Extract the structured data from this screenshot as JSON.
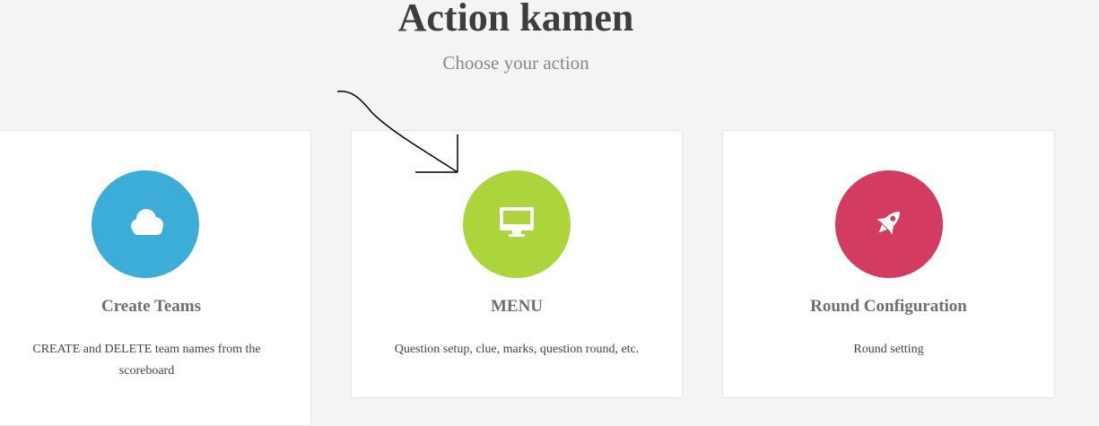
{
  "header": {
    "title": "Action kamen",
    "subtitle": "Choose your action"
  },
  "cards": [
    {
      "title": "Create Teams",
      "description": "CREATE and DELETE team names from the scoreboard",
      "icon": "cloud-icon",
      "color": "#3badd6"
    },
    {
      "title": "MENU",
      "description": "Question setup, clue, marks, question round, etc.",
      "icon": "desktop-icon",
      "color": "#add43b"
    },
    {
      "title": "Round Configuration",
      "description": "Round setting",
      "icon": "rocket-icon",
      "color": "#d43b63"
    }
  ],
  "colors": {
    "background": "#f4f4f4",
    "card": "#ffffff",
    "title": "#3d3d3d"
  }
}
